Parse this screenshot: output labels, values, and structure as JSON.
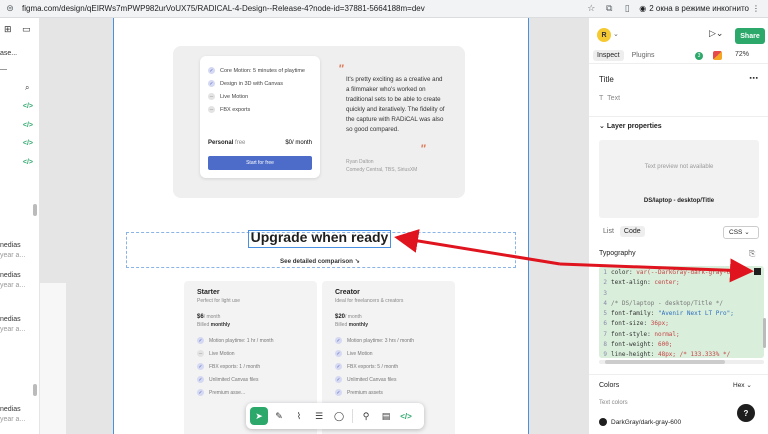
{
  "browser": {
    "url": "figma.com/design/qEIRWs7mPWP982urVoUX75/RADICAL-4-Design--Release-4?node-id=37881-5664188m=dev",
    "incognito_label": "2 окна в режиме инкогнито"
  },
  "left_panel": {
    "items": [
      {
        "label": "ase..."
      },
      {
        "label": "nedias"
      },
      {
        "label": "year a..."
      },
      {
        "label": "nedias"
      },
      {
        "label": "year a..."
      },
      {
        "label": "nedias"
      },
      {
        "label": "year a..."
      },
      {
        "label": "nedias"
      },
      {
        "label": "year a..."
      }
    ],
    "code_tag": "</>"
  },
  "canvas": {
    "plan_features": [
      {
        "label": "Core Motion: 5 minutes of playtime",
        "included": true
      },
      {
        "label": "Design in 3D with Canvas",
        "included": true
      },
      {
        "label": "Live Motion",
        "included": false
      },
      {
        "label": "FBX exports",
        "included": false
      }
    ],
    "personal": {
      "name": "Personal",
      "tag": "free",
      "price": "$0/ month"
    },
    "start_button": "Start for free",
    "quote": "It's pretty exciting as a creative and a filmmaker who's worked on traditional sets to be able to create quickly and iteratively. The fidelity of the capture with RADiCAL was also so good compared.",
    "quote_author": {
      "name": "Ryan Dalton",
      "org": "Comedy Central, TBS, SiriusXM"
    },
    "section_title": "Upgrade when ready",
    "compare_link": "See detailed comparison ↘",
    "pricing": [
      {
        "name": "Starter",
        "desc": "Perfect for light use",
        "price": "$6",
        "per": "/ month",
        "billed_prefix": "Billed",
        "billed": "monthly",
        "features": [
          {
            "label": "Motion playtime: 1 hr / month",
            "included": true
          },
          {
            "label": "Live Motion",
            "included": false
          },
          {
            "label": "FBX exports: 1 / month",
            "included": true
          },
          {
            "label": "Unlimited Canvas files",
            "included": true
          },
          {
            "label": "Premium asse...",
            "included": true
          }
        ]
      },
      {
        "name": "Creator",
        "desc": "Ideal for freelancers & creators",
        "price": "$20",
        "per": "/ month",
        "billed_prefix": "Billed",
        "billed": "monthly",
        "features": [
          {
            "label": "Motion playtime: 3 hrs / month",
            "included": true
          },
          {
            "label": "Live Motion",
            "included": true
          },
          {
            "label": "FBX exports: 5 / month",
            "included": true
          },
          {
            "label": "Unlimited Canvas files",
            "included": true
          },
          {
            "label": "Premium assets",
            "included": true
          }
        ]
      }
    ]
  },
  "right_panel": {
    "avatar": "R",
    "share": "Share",
    "tabs": [
      "Inspect",
      "Plugins"
    ],
    "zoom": "72%",
    "badge_count": "3",
    "selection_title": "Title",
    "selection_type": "Text",
    "layer_properties": "Layer properties",
    "preview_na": "Text preview not available",
    "preview_name": "DS/laptop - desktop/Title",
    "view_tabs": [
      "List",
      "Code"
    ],
    "lang": "CSS",
    "typography": "Typography",
    "code_lines": [
      {
        "n": "1",
        "prop": "color: ",
        "val": "var(--DarkGray-dark-gray-6..."
      },
      {
        "n": "2",
        "prop": "text-align: ",
        "val": "center;"
      },
      {
        "n": "3",
        "prop": "",
        "val": ""
      },
      {
        "n": "4",
        "prop": "/* DS/laptop - desktop/Title */",
        "val": ""
      },
      {
        "n": "5",
        "prop": "font-family: ",
        "val": "\"Avenir Next LT Pro\";"
      },
      {
        "n": "6",
        "prop": "font-size: ",
        "val": "36px;"
      },
      {
        "n": "7",
        "prop": "font-style: ",
        "val": "normal;"
      },
      {
        "n": "8",
        "prop": "font-weight: ",
        "val": "600;"
      },
      {
        "n": "9",
        "prop": "line-height: ",
        "val": "48px; /* 133.333% */"
      }
    ],
    "colors": "Colors",
    "color_format": "Hex",
    "text_colors": "Text colors",
    "color_name": "DarkGray/dark-gray-600",
    "help": "?"
  },
  "colors": {
    "accent_green": "#2ca86b",
    "selection_blue": "#4a90e2",
    "button_blue": "#4d6cc9",
    "annotation_red": "#e0141e"
  }
}
